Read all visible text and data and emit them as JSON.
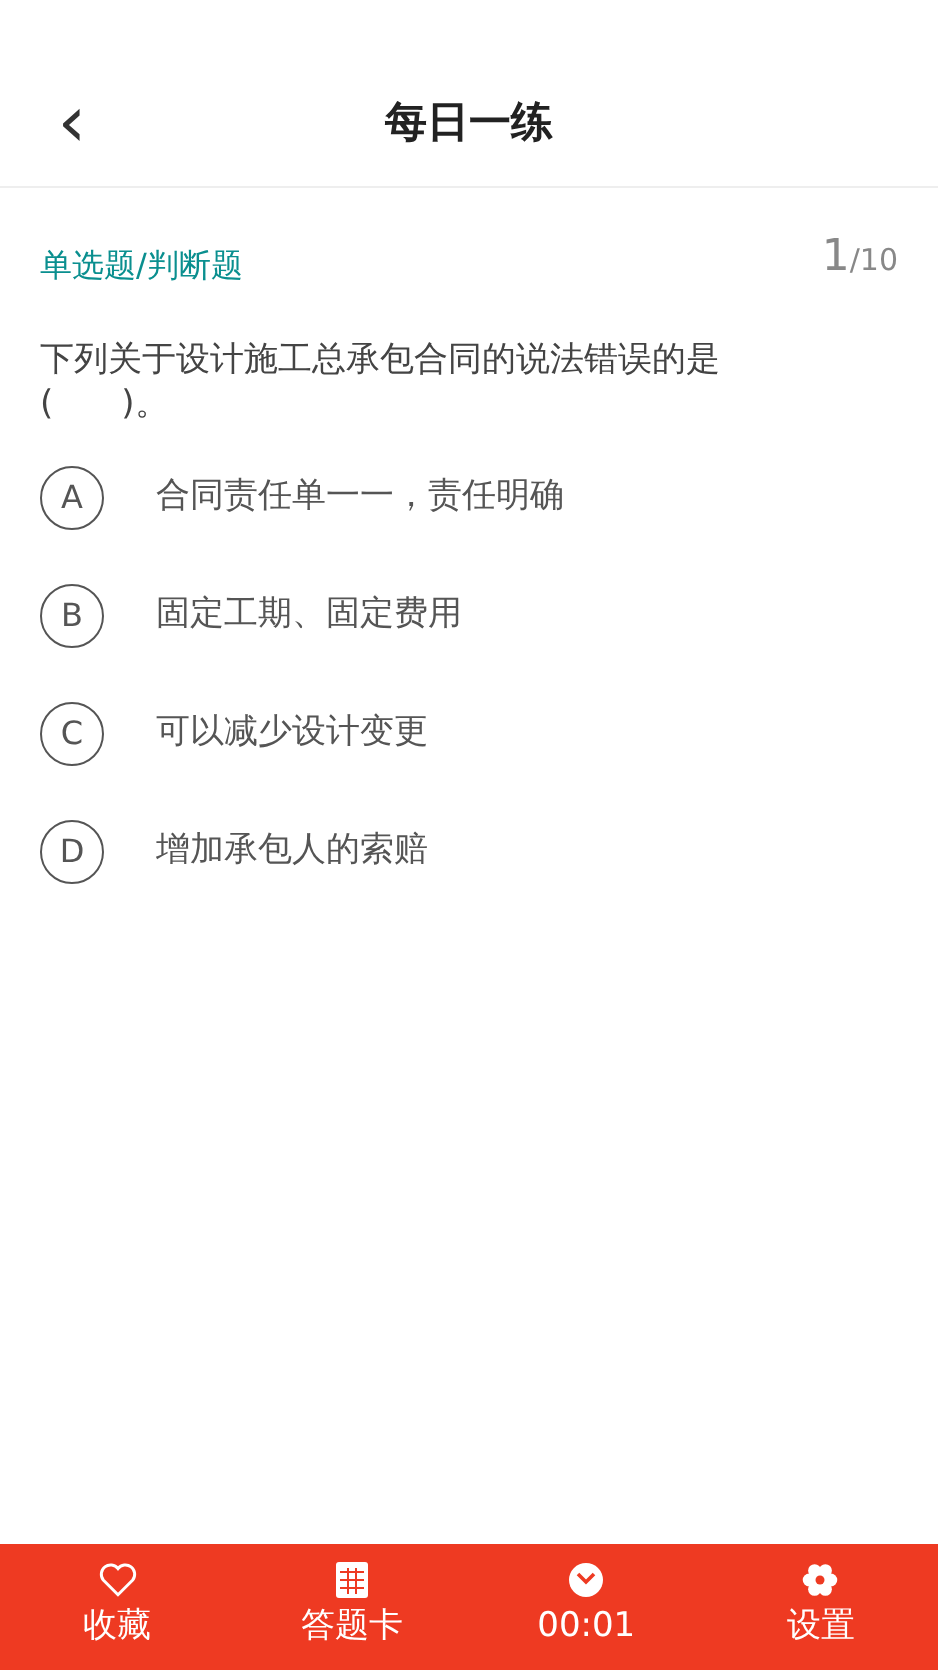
{
  "header": {
    "back": "‹",
    "title": "每日一练"
  },
  "question": {
    "type": "单选题/判断题",
    "index": "1",
    "total": "/10",
    "text": "下列关于设计施工总承包合同的说法错误的是(　　)。",
    "options": [
      {
        "letter": "A",
        "text": "合同责任单一一，责任明确",
        "selected": false
      },
      {
        "letter": "B",
        "text": "固定工期、固定费用",
        "selected": false
      },
      {
        "letter": "C",
        "text": "可以减少设计变更",
        "selected": false
      },
      {
        "letter": "D",
        "text": "增加承包人的索赔",
        "selected": false
      }
    ]
  },
  "bottom_bar": [
    {
      "kind": "favorite",
      "label": "收藏"
    },
    {
      "kind": "card",
      "label": "答题卡"
    },
    {
      "kind": "timer",
      "label": "00:01"
    },
    {
      "kind": "settings",
      "label": "设置"
    }
  ]
}
